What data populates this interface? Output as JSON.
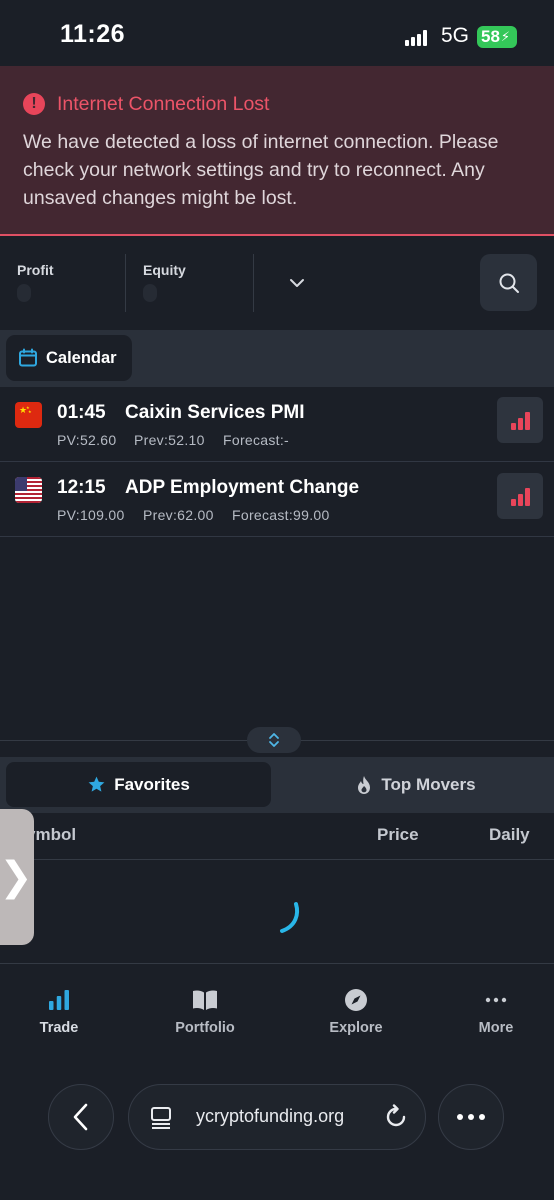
{
  "status_bar": {
    "time": "11:26",
    "network": "5G",
    "battery": "58"
  },
  "alert": {
    "title": "Internet Connection Lost",
    "message": "We have detected a loss of internet connection. Please check your network settings and try to reconnect. Any unsaved changes might be lost.",
    "color": "#e8455a"
  },
  "header": {
    "metrics": [
      {
        "label": "Profit"
      },
      {
        "label": "Equity"
      }
    ],
    "dropdown_icon": "chevron-down-icon",
    "search_icon": "search-icon"
  },
  "calendar": {
    "chip_label": "Calendar",
    "events": [
      {
        "flag": "CN",
        "time": "01:45",
        "title": "Caixin Services PMI",
        "pv": "PV:52.60",
        "prev": "Prev:52.10",
        "forecast": "Forecast:-",
        "impact_level": 3
      },
      {
        "flag": "US",
        "time": "12:15",
        "title": "ADP Employment Change",
        "pv": "PV:109.00",
        "prev": "Prev:62.00",
        "forecast": "Forecast:99.00",
        "impact_level": 3
      }
    ]
  },
  "market_tabs": {
    "favorites": "Favorites",
    "top_movers": "Top Movers",
    "active": "favorites"
  },
  "table": {
    "columns": [
      "ymbol",
      "Price",
      "Daily"
    ]
  },
  "bottom_nav": [
    {
      "label": "Trade",
      "icon": "bar-chart-icon",
      "active": true
    },
    {
      "label": "Portfolio",
      "icon": "book-icon",
      "active": false
    },
    {
      "label": "Explore",
      "icon": "compass-icon",
      "active": false
    },
    {
      "label": "More",
      "icon": "more-dots-icon",
      "active": false
    }
  ],
  "browser": {
    "url": "ycryptofunding.org"
  },
  "colors": {
    "accent": "#2fa8e0",
    "alert": "#e8455a",
    "background": "#1b1f27"
  }
}
